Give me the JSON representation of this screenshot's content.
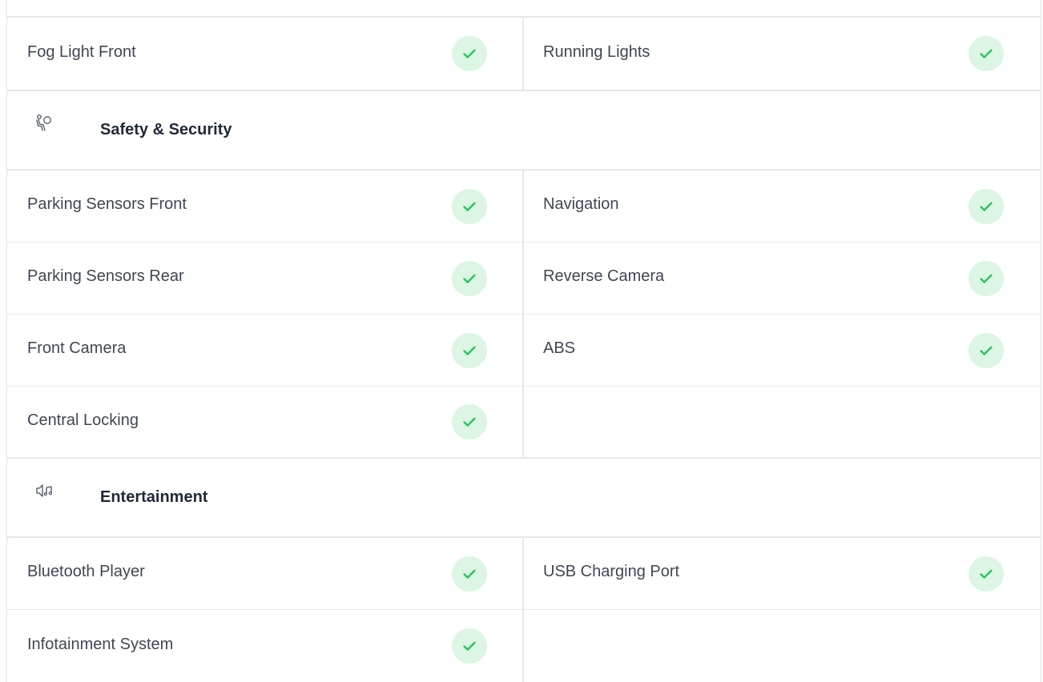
{
  "groups": [
    {
      "title": "",
      "rows": [
        {
          "left": "Fog Light Front",
          "right": "Running Lights"
        }
      ]
    },
    {
      "title": "Safety & Security",
      "icon": "airbag-icon",
      "rows": [
        {
          "left": "Parking Sensors Front",
          "right": "Navigation"
        },
        {
          "left": "Parking Sensors Rear",
          "right": "Reverse Camera"
        },
        {
          "left": "Front Camera",
          "right": "ABS"
        },
        {
          "left": "Central Locking",
          "right": ""
        }
      ]
    },
    {
      "title": "Entertainment",
      "icon": "speaker-music-icon",
      "rows": [
        {
          "left": "Bluetooth Player",
          "right": "USB Charging Port"
        },
        {
          "left": "Infotainment System",
          "right": ""
        }
      ]
    }
  ],
  "colors": {
    "check_bg": "#dcf5e4",
    "check_mark": "#22c55e",
    "border": "#e4e8ec"
  }
}
